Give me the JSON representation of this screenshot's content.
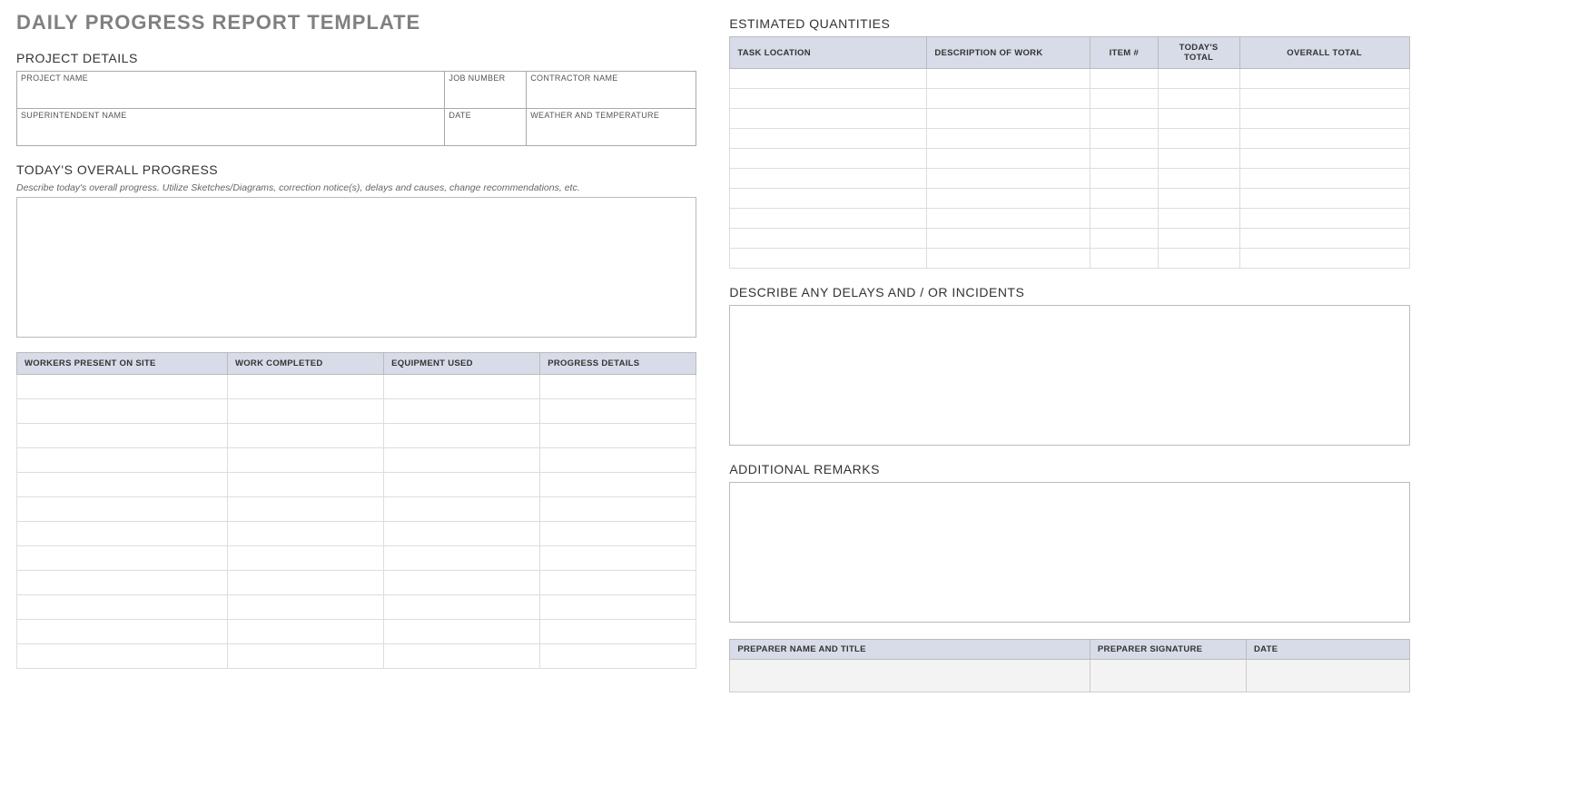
{
  "title": "DAILY PROGRESS REPORT TEMPLATE",
  "sections": {
    "project_details": "PROJECT DETAILS",
    "overall_progress": "TODAY'S OVERALL PROGRESS",
    "estimated_quantities": "ESTIMATED QUANTITIES",
    "delays": "DESCRIBE ANY DELAYS AND / OR INCIDENTS",
    "remarks": "ADDITIONAL REMARKS"
  },
  "project_fields": {
    "project_name_label": "PROJECT NAME",
    "project_name_value": "",
    "job_number_label": "JOB NUMBER",
    "job_number_value": "",
    "contractor_name_label": "CONTRACTOR NAME",
    "contractor_name_value": "",
    "superintendent_label": "SUPERINTENDENT NAME",
    "superintendent_value": "",
    "date_label": "DATE",
    "date_value": "",
    "weather_label": "WEATHER AND TEMPERATURE",
    "weather_value": ""
  },
  "progress_hint": "Describe today's overall progress.  Utilize Sketches/Diagrams, correction notice(s), delays and causes, change recommendations, etc.",
  "progress_value": "",
  "workers_table": {
    "headers": [
      "WORKERS PRESENT ON SITE",
      "WORK COMPLETED",
      "EQUIPMENT USED",
      "PROGRESS DETAILS"
    ],
    "rows": [
      [
        "",
        "",
        "",
        ""
      ],
      [
        "",
        "",
        "",
        ""
      ],
      [
        "",
        "",
        "",
        ""
      ],
      [
        "",
        "",
        "",
        ""
      ],
      [
        "",
        "",
        "",
        ""
      ],
      [
        "",
        "",
        "",
        ""
      ],
      [
        "",
        "",
        "",
        ""
      ],
      [
        "",
        "",
        "",
        ""
      ],
      [
        "",
        "",
        "",
        ""
      ],
      [
        "",
        "",
        "",
        ""
      ],
      [
        "",
        "",
        "",
        ""
      ],
      [
        "",
        "",
        "",
        ""
      ]
    ]
  },
  "quantities_table": {
    "headers": [
      "TASK LOCATION",
      "DESCRIPTION OF WORK",
      "ITEM #",
      "TODAY'S TOTAL",
      "OVERALL TOTAL"
    ],
    "rows": [
      [
        "",
        "",
        "",
        "",
        ""
      ],
      [
        "",
        "",
        "",
        "",
        ""
      ],
      [
        "",
        "",
        "",
        "",
        ""
      ],
      [
        "",
        "",
        "",
        "",
        ""
      ],
      [
        "",
        "",
        "",
        "",
        ""
      ],
      [
        "",
        "",
        "",
        "",
        ""
      ],
      [
        "",
        "",
        "",
        "",
        ""
      ],
      [
        "",
        "",
        "",
        "",
        ""
      ],
      [
        "",
        "",
        "",
        "",
        ""
      ],
      [
        "",
        "",
        "",
        "",
        ""
      ]
    ]
  },
  "delays_value": "",
  "remarks_value": "",
  "preparer_table": {
    "headers": [
      "PREPARER NAME AND TITLE",
      "PREPARER SIGNATURE",
      "DATE"
    ],
    "row": [
      "",
      "",
      ""
    ]
  }
}
